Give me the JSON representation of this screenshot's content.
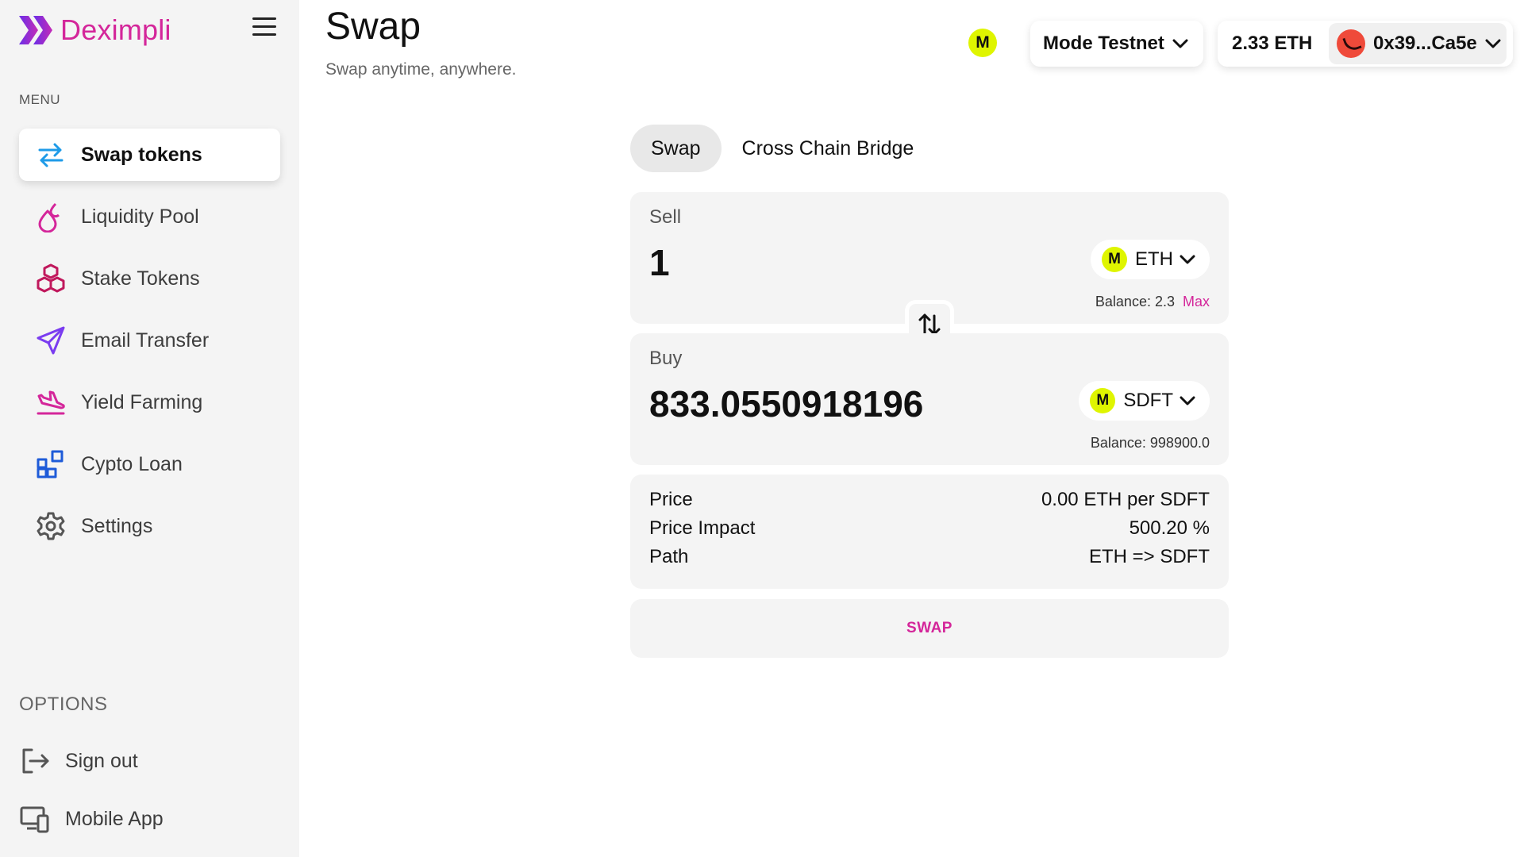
{
  "brand": {
    "name": "Deximpli"
  },
  "sidebar": {
    "menu_label": "MENU",
    "items": [
      {
        "label": "Swap tokens",
        "icon": "swap-arrows-icon",
        "active": true
      },
      {
        "label": "Liquidity Pool",
        "icon": "droplets-icon"
      },
      {
        "label": "Stake Tokens",
        "icon": "cubes-icon"
      },
      {
        "label": "Email Transfer",
        "icon": "paper-plane-icon"
      },
      {
        "label": "Yield Farming",
        "icon": "plane-landing-icon"
      },
      {
        "label": "Cypto Loan",
        "icon": "apps-icon"
      },
      {
        "label": "Settings",
        "icon": "gear-icon"
      }
    ],
    "options_label": "OPTIONS",
    "options": [
      {
        "label": "Sign out",
        "icon": "sign-out-icon"
      },
      {
        "label": "Mobile App",
        "icon": "devices-icon"
      }
    ]
  },
  "header": {
    "title": "Swap",
    "subtitle": "Swap anytime, anywhere.",
    "network_badge": "M",
    "chain": "Mode Testnet",
    "balance": "2.33 ETH",
    "address": "0x39...Ca5e"
  },
  "tabs": [
    "Swap",
    "Cross Chain Bridge"
  ],
  "sell": {
    "label": "Sell",
    "amount": "1",
    "token": "ETH",
    "token_icon": "M",
    "balance": "Balance: 2.3",
    "max": "Max"
  },
  "buy": {
    "label": "Buy",
    "amount": "833.0550918196",
    "token": "SDFT",
    "token_icon": "M",
    "balance": "Balance: 998900.0"
  },
  "info": {
    "price_label": "Price",
    "price_value": "0.00 ETH per SDFT",
    "impact_label": "Price Impact",
    "impact_value": "500.20 %",
    "path_label": "Path",
    "path_value": "ETH => SDFT"
  },
  "swap_button": "SWAP",
  "colors": {
    "brand": "#d4269a",
    "token_badge": "#dff500",
    "sidebar_bg": "#f4f4f4"
  }
}
